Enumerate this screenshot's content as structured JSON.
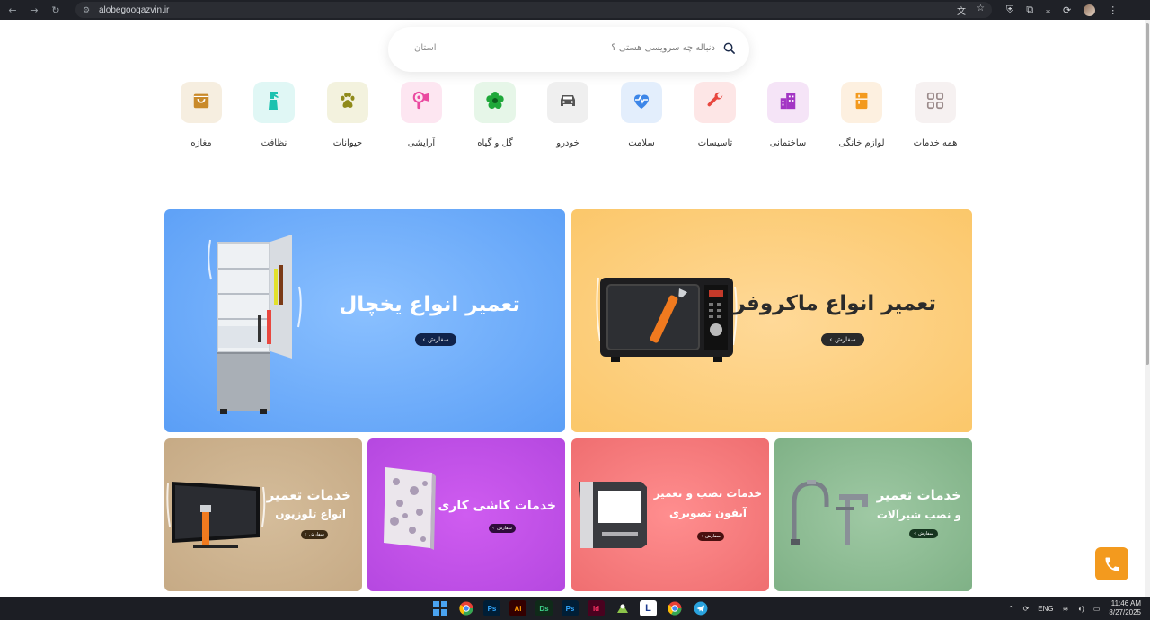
{
  "browser": {
    "url": "alobegooqazvin.ir"
  },
  "search": {
    "province_label": "استان",
    "placeholder": "دنباله چه سرویسی هستی ؟"
  },
  "categories": [
    {
      "label": "همه خدمات",
      "icon": "grid-icon",
      "bg": "#f6f1f1",
      "fg": "#9a8a8a"
    },
    {
      "label": "لوازم خانگی",
      "icon": "fridge-icon",
      "bg": "#fdf0e0",
      "fg": "#f39a1e"
    },
    {
      "label": "ساختمانی",
      "icon": "building-icon",
      "bg": "#f5e4f7",
      "fg": "#a335c4"
    },
    {
      "label": "تاسیسات",
      "icon": "wrench-icon",
      "bg": "#fde6e6",
      "fg": "#e8473f"
    },
    {
      "label": "سلامت",
      "icon": "heartbeat-icon",
      "bg": "#e3eefc",
      "fg": "#3d86e8"
    },
    {
      "label": "خودرو",
      "icon": "car-icon",
      "bg": "#efefef",
      "fg": "#555555"
    },
    {
      "label": "گل و گیاه",
      "icon": "flower-icon",
      "bg": "#e6f6e8",
      "fg": "#1fa83a"
    },
    {
      "label": "آرایشی",
      "icon": "hairdryer-icon",
      "bg": "#fde6f1",
      "fg": "#ea4aa0"
    },
    {
      "label": "حیوانات",
      "icon": "paw-icon",
      "bg": "#f3f2de",
      "fg": "#8f8a1a"
    },
    {
      "label": "نظافت",
      "icon": "spray-icon",
      "bg": "#e0f7f5",
      "fg": "#1cc2b0"
    },
    {
      "label": "مغازه",
      "icon": "shop-icon",
      "bg": "#f6eee0",
      "fg": "#c98a2a"
    }
  ],
  "banners": {
    "microwave": {
      "title": "تعمیر انواع ماکروفر",
      "order_label": "سفارش",
      "color": "#fbcb6e"
    },
    "fridge": {
      "title": "تعمیر انواع یخچال",
      "order_label": "سفارش",
      "color": "#5aa0f8"
    },
    "faucet": {
      "title_line1": "خدمات تعمیر",
      "title_line2": "و نصب شیرآلات",
      "order_label": "سفارش",
      "color": "#87b98d"
    },
    "intercom": {
      "title_line1": "خدمات نصب و تعمیر",
      "title_line2": "آیفون تصویری",
      "order_label": "سفارش",
      "color": "#f2787a"
    },
    "tiles": {
      "title": "خدمات کاشی کاری",
      "order_label": "سفارش",
      "color": "#b548e0"
    },
    "tv": {
      "title_line1": "خدمات تعمیر",
      "title_line2": "انواع تلوزیون",
      "order_label": "سفارش",
      "color": "#c9ae8a"
    }
  },
  "taskbar": {
    "apps": [
      "windows-start-icon",
      "chrome-icon",
      "photoshop-icon",
      "illustrator-icon",
      "dimension-icon",
      "photoshop-icon",
      "indesign-icon",
      "maps-icon",
      "l-app-icon",
      "chrome-icon",
      "telegram-icon"
    ],
    "app_labels": {
      "photoshop": "Ps",
      "illustrator": "Ai",
      "dimension": "Ds",
      "indesign": "Id",
      "l_app": "L"
    },
    "language": "ENG",
    "time": "11:46 AM",
    "date": "8/27/2025"
  }
}
